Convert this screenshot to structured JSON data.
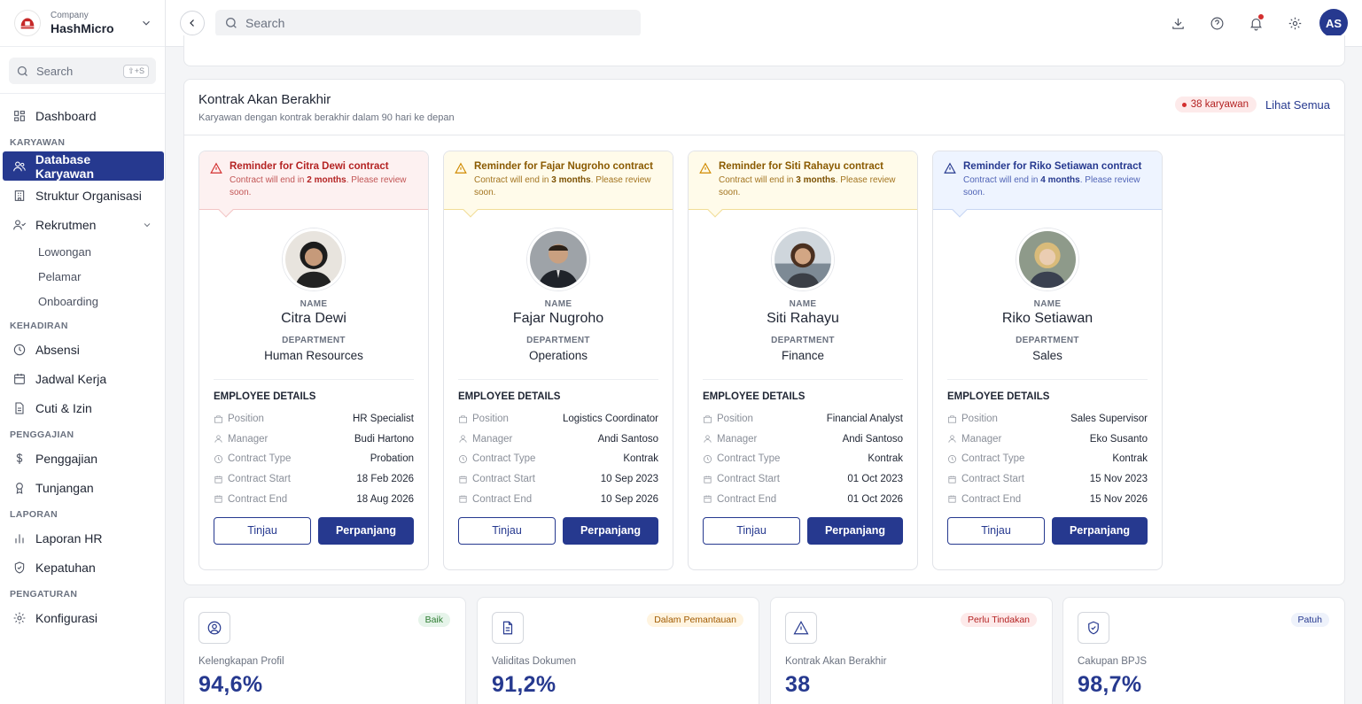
{
  "company": {
    "label": "Company",
    "name": "HashMicro"
  },
  "sidebar": {
    "search_placeholder": "Search",
    "search_shortcut": "⇧+S",
    "dashboard": "Dashboard",
    "sections": {
      "karyawan": "KARYAWAN",
      "kehadiran": "KEHADIRAN",
      "penggajian": "PENGGAJIAN",
      "laporan": "LAPORAN",
      "pengaturan": "PENGATURAN"
    },
    "items": {
      "database_karyawan": "Database Karyawan",
      "struktur_organisasi": "Struktur Organisasi",
      "rekrutmen": "Rekrutmen",
      "lowongan": "Lowongan",
      "pelamar": "Pelamar",
      "onboarding": "Onboarding",
      "absensi": "Absensi",
      "jadwal_kerja": "Jadwal Kerja",
      "cuti_izin": "Cuti & Izin",
      "penggajian": "Penggajian",
      "tunjangan": "Tunjangan",
      "laporan_hr": "Laporan HR",
      "kepatuhan": "Kepatuhan",
      "konfigurasi": "Konfigurasi"
    }
  },
  "topbar": {
    "search_placeholder": "Search",
    "user_initials": "AS"
  },
  "contract_panel": {
    "title": "Kontrak Akan Berakhir",
    "subtitle": "Karyawan dengan kontrak berakhir dalam 90 hari ke depan",
    "count_badge": "38 karyawan",
    "see_all": "Lihat Semua"
  },
  "card_labels": {
    "name": "NAME",
    "department": "DEPARTMENT",
    "details_header": "EMPLOYEE DETAILS",
    "position": "Position",
    "manager": "Manager",
    "contract_type": "Contract Type",
    "contract_start": "Contract Start",
    "contract_end": "Contract End",
    "review_button": "Tinjau",
    "extend_button": "Perpanjang",
    "reminder_pre": "Contract will end in",
    "reminder_post": ". Please review soon."
  },
  "employees": [
    {
      "reminder_title": "Reminder for Citra Dewi contract",
      "reminder_period": "2 months",
      "name": "Citra Dewi",
      "department": "Human Resources",
      "position": "HR Specialist",
      "manager": "Budi Hartono",
      "contract_type": "Probation",
      "contract_start": "18 Feb 2026",
      "contract_end": "18 Aug 2026",
      "level": "red"
    },
    {
      "reminder_title": "Reminder for Fajar Nugroho contract",
      "reminder_period": "3 months",
      "name": "Fajar Nugroho",
      "department": "Operations",
      "position": "Logistics Coordinator",
      "manager": "Andi Santoso",
      "contract_type": "Kontrak",
      "contract_start": "10 Sep 2023",
      "contract_end": "10 Sep 2026",
      "level": "yellow"
    },
    {
      "reminder_title": "Reminder for Siti Rahayu contract",
      "reminder_period": "3 months",
      "name": "Siti Rahayu",
      "department": "Finance",
      "position": "Financial Analyst",
      "manager": "Andi Santoso",
      "contract_type": "Kontrak",
      "contract_start": "01 Oct 2023",
      "contract_end": "01 Oct 2026",
      "level": "yellow"
    },
    {
      "reminder_title": "Reminder for Riko Setiawan contract",
      "reminder_period": "4 months",
      "name": "Riko Setiawan",
      "department": "Sales",
      "position": "Sales Supervisor",
      "manager": "Eko Susanto",
      "contract_type": "Kontrak",
      "contract_start": "15 Nov 2023",
      "contract_end": "15 Nov 2026",
      "level": "blue"
    }
  ],
  "stats": [
    {
      "label": "Kelengkapan Profil",
      "value": "94,6%",
      "badge": "Baik",
      "icon": "user-circle-icon",
      "badge_bg": "#e6f4ea",
      "badge_color": "#2e7d32"
    },
    {
      "label": "Validitas Dokumen",
      "value": "91,2%",
      "badge": "Dalam Pemantauan",
      "icon": "document-icon",
      "badge_bg": "#fff4e0",
      "badge_color": "#a05a00"
    },
    {
      "label": "Kontrak Akan Berakhir",
      "value": "38",
      "badge": "Perlu Tindakan",
      "icon": "warning-icon",
      "badge_bg": "#fdeaea",
      "badge_color": "#b42323"
    },
    {
      "label": "Cakupan BPJS",
      "value": "98,7%",
      "badge": "Patuh",
      "icon": "shield-check-icon",
      "badge_bg": "#eef2fb",
      "badge_color": "#26398f"
    }
  ],
  "colors": {
    "brand": "#26398f",
    "danger": "#d32f2f"
  }
}
